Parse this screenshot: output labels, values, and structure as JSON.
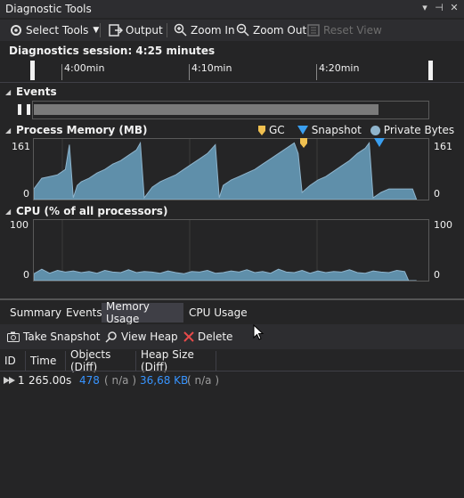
{
  "window": {
    "title": "Diagnostic Tools",
    "controls": [
      "▾",
      "⊣",
      "✕"
    ]
  },
  "toolbar": {
    "select_tools": "Select Tools",
    "output": "Output",
    "zoom_in": "Zoom In",
    "zoom_out": "Zoom Out",
    "reset_view": "Reset View"
  },
  "session": {
    "label": "Diagnostics session: 4:25 minutes"
  },
  "timeline": {
    "ticks": [
      "4:00min",
      "4:10min",
      "4:20min"
    ]
  },
  "events": {
    "title": "Events"
  },
  "memory": {
    "title": "Process Memory (MB)",
    "legend": {
      "gc": "GC",
      "snapshot": "Snapshot",
      "private_bytes": "Private Bytes"
    },
    "y_max": "161",
    "y_min": "0"
  },
  "cpu": {
    "title": "CPU (% of all processors)",
    "y_max": "100",
    "y_min": "0"
  },
  "tabs": [
    "Summary",
    "Events",
    "Memory Usage",
    "CPU Usage"
  ],
  "actions": {
    "take_snapshot": "Take Snapshot",
    "view_heap": "View Heap",
    "delete": "Delete"
  },
  "table": {
    "headers": [
      "ID",
      "Time",
      "Objects (Diff)",
      "Heap Size (Diff)"
    ],
    "rows": [
      {
        "id": "1",
        "time": "265.00s",
        "objects": "478",
        "objects_diff": "( n/a )",
        "heap": "36,68 KB",
        "heap_diff": "( n/a )"
      }
    ]
  },
  "colors": {
    "accent": "#3794ff",
    "memory_fill": "#5f8faa",
    "gc_marker": "#f0c050",
    "snapshot_marker": "#3a9ff0"
  },
  "chart_data": [
    {
      "type": "area",
      "title": "Process Memory (MB)",
      "ylim": [
        0,
        161
      ],
      "x": [
        0,
        2,
        4,
        6,
        8,
        9,
        10,
        11,
        12,
        14,
        16,
        18,
        20,
        22,
        24,
        26,
        27,
        28,
        30,
        32,
        34,
        36,
        38,
        40,
        42,
        44,
        46,
        47,
        48,
        50,
        52,
        54,
        56,
        58,
        60,
        62,
        64,
        66,
        67,
        68,
        70,
        72,
        74,
        76,
        78,
        80,
        82,
        84,
        85,
        86,
        88,
        90,
        92,
        94,
        96,
        97
      ],
      "values": [
        30,
        60,
        65,
        70,
        85,
        155,
        5,
        40,
        50,
        60,
        75,
        85,
        100,
        110,
        125,
        140,
        160,
        5,
        35,
        50,
        60,
        70,
        85,
        100,
        115,
        130,
        155,
        5,
        40,
        55,
        65,
        75,
        85,
        100,
        115,
        130,
        145,
        160,
        130,
        20,
        40,
        55,
        65,
        80,
        95,
        110,
        130,
        145,
        160,
        5,
        20,
        30,
        30,
        30,
        30,
        0
      ],
      "legend": [
        "GC",
        "Snapshot",
        "Private Bytes"
      ]
    },
    {
      "type": "area",
      "title": "CPU (% of all processors)",
      "ylim": [
        0,
        100
      ],
      "x": [
        0,
        2,
        4,
        6,
        8,
        10,
        12,
        14,
        16,
        18,
        20,
        22,
        24,
        26,
        28,
        30,
        32,
        34,
        36,
        38,
        40,
        42,
        44,
        46,
        48,
        50,
        52,
        54,
        56,
        58,
        60,
        62,
        64,
        66,
        68,
        70,
        72,
        74,
        76,
        78,
        80,
        82,
        84,
        86,
        88,
        90,
        92,
        94,
        95,
        96,
        97
      ],
      "values": [
        12,
        20,
        13,
        18,
        15,
        17,
        14,
        16,
        13,
        18,
        15,
        14,
        19,
        14,
        16,
        15,
        13,
        17,
        14,
        12,
        16,
        15,
        18,
        13,
        14,
        17,
        15,
        19,
        14,
        16,
        13,
        20,
        15,
        14,
        18,
        13,
        17,
        14,
        16,
        15,
        19,
        14,
        13,
        17,
        15,
        14,
        18,
        16,
        0,
        0,
        0
      ]
    }
  ]
}
